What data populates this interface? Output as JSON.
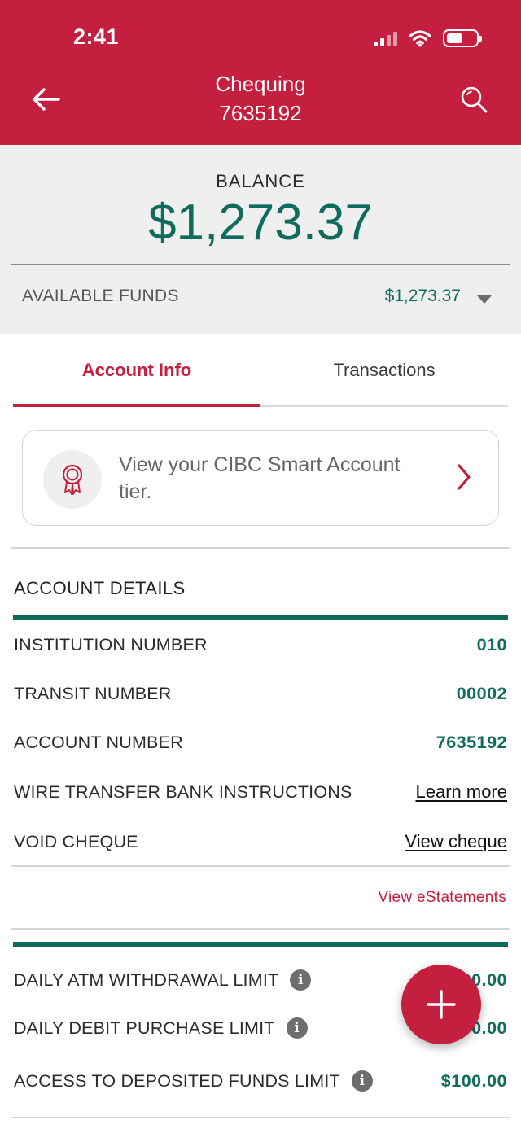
{
  "status_bar": {
    "time": "2:41"
  },
  "header": {
    "title": "Chequing",
    "account_number": "7635192",
    "icons": {
      "back": "arrow-left-icon",
      "search": "search-icon"
    }
  },
  "balance": {
    "label": "BALANCE",
    "amount": "$1,273.37",
    "available_label": "AVAILABLE FUNDS",
    "available_amount": "$1,273.37"
  },
  "tabs": [
    {
      "label": "Account Info",
      "active": true
    },
    {
      "label": "Transactions",
      "active": false
    }
  ],
  "smart_account": {
    "text": "View your CIBC Smart Account tier.",
    "icon": "award-ribbon-icon"
  },
  "account_details": {
    "title": "ACCOUNT DETAILS",
    "rows": [
      {
        "label": "INSTITUTION NUMBER",
        "value": "010"
      },
      {
        "label": "TRANSIT NUMBER",
        "value": "00002"
      },
      {
        "label": "ACCOUNT NUMBER",
        "value": "7635192"
      },
      {
        "label": "WIRE TRANSFER BANK INSTRUCTIONS",
        "link": "Learn more"
      },
      {
        "label": "VOID CHEQUE",
        "link": "View cheque"
      }
    ],
    "estatements_link": "View eStatements"
  },
  "limits": {
    "rows": [
      {
        "label": "DAILY ATM WITHDRAWAL LIMIT",
        "value": "$1,000.00"
      },
      {
        "label": "DAILY DEBIT PURCHASE LIMIT",
        "value": "$3,000.00"
      },
      {
        "label": "ACCESS TO DEPOSITED FUNDS LIMIT",
        "value": "$100.00"
      }
    ]
  },
  "fab": {
    "icon": "plus-icon"
  },
  "colors": {
    "brand_red": "#c41f3e",
    "accent_green": "#0f6b5c",
    "panel_gray": "#efefef"
  }
}
